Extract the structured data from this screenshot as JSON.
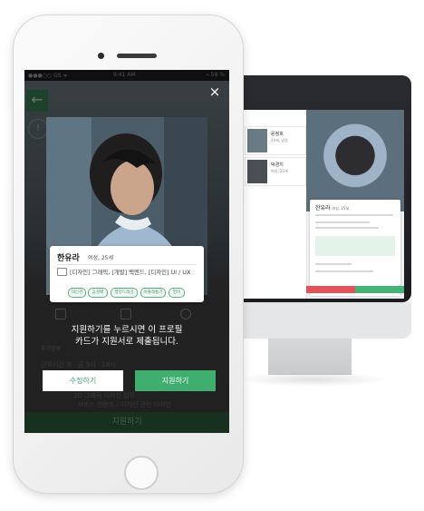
{
  "status_bar": {
    "carrier": "●●●○○ GS ᯤ",
    "time": "9:41 AM",
    "battery": "⌁ 58 %"
  },
  "app_behind": {
    "back_icon": "←",
    "info_icon": "!",
    "recommend_label": "추가정보",
    "row_work_time": "근무시간   화 · 금 9시 · 18시",
    "row_task_1": "2D 그래픽 디자인 업무",
    "row_task_2": "· 서비스 컨텐츠 / 디자인 관련 디자인",
    "apply_bar_label": "지원하기"
  },
  "modal": {
    "close_icon": "×",
    "profile": {
      "name": "한유라",
      "meta": "여성, 25세",
      "jobs": "[디자인] 그래픽, [개발] 백엔드, [디자인] UI / UX",
      "tags": [
        "대인관",
        "음성배",
        "행정드래깅",
        "비즐레통기",
        "영어"
      ]
    },
    "caption_line1": "지원하기를 누르시면 이 프로필",
    "caption_line2": "카드가 지원서로 제출됩니다.",
    "edit_button": "수정하기",
    "apply_button": "지원하기"
  },
  "monitor": {
    "list": [
      {
        "name": "윤정호",
        "sub": "24세, 남성"
      },
      {
        "name": "박경지",
        "sub": "여성, 22세"
      }
    ],
    "panel_title": "한유라",
    "panel_meta": "여성, 25세"
  },
  "colors": {
    "accent_green": "#3fae6f",
    "tag_green": "#53b47b",
    "reject_red": "#e25357"
  }
}
